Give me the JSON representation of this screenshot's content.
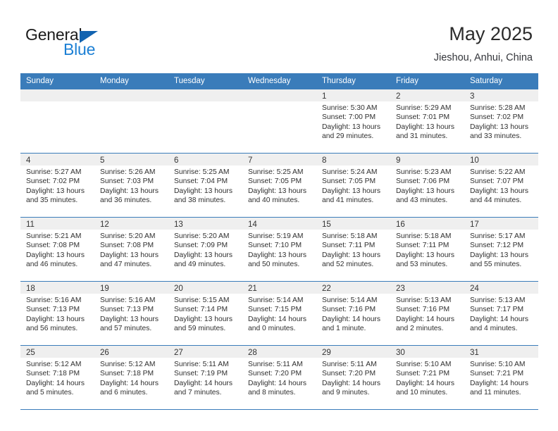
{
  "brand": {
    "name_part1": "General",
    "name_part2": "Blue",
    "triangle_color": "#1263b0"
  },
  "header": {
    "title": "May 2025",
    "subtitle": "Jieshou, Anhui, China",
    "accent_color": "#3a7cba"
  },
  "weekdays": [
    "Sunday",
    "Monday",
    "Tuesday",
    "Wednesday",
    "Thursday",
    "Friday",
    "Saturday"
  ],
  "labels": {
    "sunrise_prefix": "Sunrise:",
    "sunset_prefix": "Sunset:",
    "daylight_prefix": "Daylight:"
  },
  "weeks": [
    [
      {
        "day": "",
        "empty": true
      },
      {
        "day": "",
        "empty": true
      },
      {
        "day": "",
        "empty": true
      },
      {
        "day": "",
        "empty": true
      },
      {
        "day": "1",
        "sunrise": "Sunrise: 5:30 AM",
        "sunset": "Sunset: 7:00 PM",
        "daylight_l1": "Daylight: 13 hours",
        "daylight_l2": "and 29 minutes."
      },
      {
        "day": "2",
        "sunrise": "Sunrise: 5:29 AM",
        "sunset": "Sunset: 7:01 PM",
        "daylight_l1": "Daylight: 13 hours",
        "daylight_l2": "and 31 minutes."
      },
      {
        "day": "3",
        "sunrise": "Sunrise: 5:28 AM",
        "sunset": "Sunset: 7:02 PM",
        "daylight_l1": "Daylight: 13 hours",
        "daylight_l2": "and 33 minutes."
      }
    ],
    [
      {
        "day": "4",
        "sunrise": "Sunrise: 5:27 AM",
        "sunset": "Sunset: 7:02 PM",
        "daylight_l1": "Daylight: 13 hours",
        "daylight_l2": "and 35 minutes."
      },
      {
        "day": "5",
        "sunrise": "Sunrise: 5:26 AM",
        "sunset": "Sunset: 7:03 PM",
        "daylight_l1": "Daylight: 13 hours",
        "daylight_l2": "and 36 minutes."
      },
      {
        "day": "6",
        "sunrise": "Sunrise: 5:25 AM",
        "sunset": "Sunset: 7:04 PM",
        "daylight_l1": "Daylight: 13 hours",
        "daylight_l2": "and 38 minutes."
      },
      {
        "day": "7",
        "sunrise": "Sunrise: 5:25 AM",
        "sunset": "Sunset: 7:05 PM",
        "daylight_l1": "Daylight: 13 hours",
        "daylight_l2": "and 40 minutes."
      },
      {
        "day": "8",
        "sunrise": "Sunrise: 5:24 AM",
        "sunset": "Sunset: 7:05 PM",
        "daylight_l1": "Daylight: 13 hours",
        "daylight_l2": "and 41 minutes."
      },
      {
        "day": "9",
        "sunrise": "Sunrise: 5:23 AM",
        "sunset": "Sunset: 7:06 PM",
        "daylight_l1": "Daylight: 13 hours",
        "daylight_l2": "and 43 minutes."
      },
      {
        "day": "10",
        "sunrise": "Sunrise: 5:22 AM",
        "sunset": "Sunset: 7:07 PM",
        "daylight_l1": "Daylight: 13 hours",
        "daylight_l2": "and 44 minutes."
      }
    ],
    [
      {
        "day": "11",
        "sunrise": "Sunrise: 5:21 AM",
        "sunset": "Sunset: 7:08 PM",
        "daylight_l1": "Daylight: 13 hours",
        "daylight_l2": "and 46 minutes."
      },
      {
        "day": "12",
        "sunrise": "Sunrise: 5:20 AM",
        "sunset": "Sunset: 7:08 PM",
        "daylight_l1": "Daylight: 13 hours",
        "daylight_l2": "and 47 minutes."
      },
      {
        "day": "13",
        "sunrise": "Sunrise: 5:20 AM",
        "sunset": "Sunset: 7:09 PM",
        "daylight_l1": "Daylight: 13 hours",
        "daylight_l2": "and 49 minutes."
      },
      {
        "day": "14",
        "sunrise": "Sunrise: 5:19 AM",
        "sunset": "Sunset: 7:10 PM",
        "daylight_l1": "Daylight: 13 hours",
        "daylight_l2": "and 50 minutes."
      },
      {
        "day": "15",
        "sunrise": "Sunrise: 5:18 AM",
        "sunset": "Sunset: 7:11 PM",
        "daylight_l1": "Daylight: 13 hours",
        "daylight_l2": "and 52 minutes."
      },
      {
        "day": "16",
        "sunrise": "Sunrise: 5:18 AM",
        "sunset": "Sunset: 7:11 PM",
        "daylight_l1": "Daylight: 13 hours",
        "daylight_l2": "and 53 minutes."
      },
      {
        "day": "17",
        "sunrise": "Sunrise: 5:17 AM",
        "sunset": "Sunset: 7:12 PM",
        "daylight_l1": "Daylight: 13 hours",
        "daylight_l2": "and 55 minutes."
      }
    ],
    [
      {
        "day": "18",
        "sunrise": "Sunrise: 5:16 AM",
        "sunset": "Sunset: 7:13 PM",
        "daylight_l1": "Daylight: 13 hours",
        "daylight_l2": "and 56 minutes."
      },
      {
        "day": "19",
        "sunrise": "Sunrise: 5:16 AM",
        "sunset": "Sunset: 7:13 PM",
        "daylight_l1": "Daylight: 13 hours",
        "daylight_l2": "and 57 minutes."
      },
      {
        "day": "20",
        "sunrise": "Sunrise: 5:15 AM",
        "sunset": "Sunset: 7:14 PM",
        "daylight_l1": "Daylight: 13 hours",
        "daylight_l2": "and 59 minutes."
      },
      {
        "day": "21",
        "sunrise": "Sunrise: 5:14 AM",
        "sunset": "Sunset: 7:15 PM",
        "daylight_l1": "Daylight: 14 hours",
        "daylight_l2": "and 0 minutes."
      },
      {
        "day": "22",
        "sunrise": "Sunrise: 5:14 AM",
        "sunset": "Sunset: 7:16 PM",
        "daylight_l1": "Daylight: 14 hours",
        "daylight_l2": "and 1 minute."
      },
      {
        "day": "23",
        "sunrise": "Sunrise: 5:13 AM",
        "sunset": "Sunset: 7:16 PM",
        "daylight_l1": "Daylight: 14 hours",
        "daylight_l2": "and 2 minutes."
      },
      {
        "day": "24",
        "sunrise": "Sunrise: 5:13 AM",
        "sunset": "Sunset: 7:17 PM",
        "daylight_l1": "Daylight: 14 hours",
        "daylight_l2": "and 4 minutes."
      }
    ],
    [
      {
        "day": "25",
        "sunrise": "Sunrise: 5:12 AM",
        "sunset": "Sunset: 7:18 PM",
        "daylight_l1": "Daylight: 14 hours",
        "daylight_l2": "and 5 minutes."
      },
      {
        "day": "26",
        "sunrise": "Sunrise: 5:12 AM",
        "sunset": "Sunset: 7:18 PM",
        "daylight_l1": "Daylight: 14 hours",
        "daylight_l2": "and 6 minutes."
      },
      {
        "day": "27",
        "sunrise": "Sunrise: 5:11 AM",
        "sunset": "Sunset: 7:19 PM",
        "daylight_l1": "Daylight: 14 hours",
        "daylight_l2": "and 7 minutes."
      },
      {
        "day": "28",
        "sunrise": "Sunrise: 5:11 AM",
        "sunset": "Sunset: 7:20 PM",
        "daylight_l1": "Daylight: 14 hours",
        "daylight_l2": "and 8 minutes."
      },
      {
        "day": "29",
        "sunrise": "Sunrise: 5:11 AM",
        "sunset": "Sunset: 7:20 PM",
        "daylight_l1": "Daylight: 14 hours",
        "daylight_l2": "and 9 minutes."
      },
      {
        "day": "30",
        "sunrise": "Sunrise: 5:10 AM",
        "sunset": "Sunset: 7:21 PM",
        "daylight_l1": "Daylight: 14 hours",
        "daylight_l2": "and 10 minutes."
      },
      {
        "day": "31",
        "sunrise": "Sunrise: 5:10 AM",
        "sunset": "Sunset: 7:21 PM",
        "daylight_l1": "Daylight: 14 hours",
        "daylight_l2": "and 11 minutes."
      }
    ]
  ]
}
